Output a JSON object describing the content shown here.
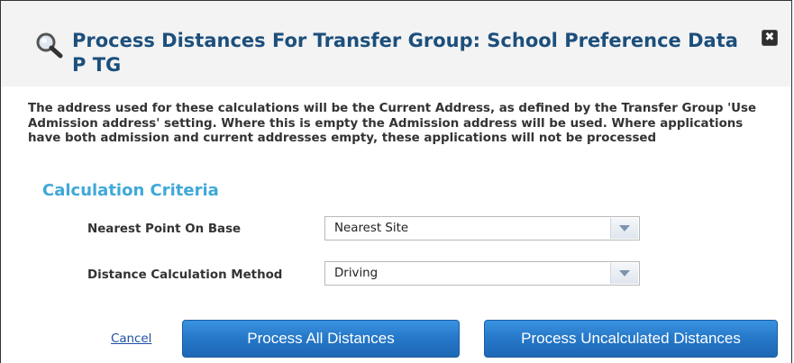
{
  "dialog": {
    "title": "Process Distances For Transfer Group: School Preference Data P TG",
    "close_glyph": "✖",
    "header_icon": "magnifier-icon",
    "description": "The address used for these calculations will be the Current Address, as defined by the Transfer Group 'Use Admission address' setting. Where this is empty the Admission address will be used. Where applications have both admission and current addresses empty, these applications will not be processed"
  },
  "criteria": {
    "section_title": "Calculation Criteria",
    "fields": [
      {
        "label": "Nearest Point On Base",
        "value": "Nearest Site"
      },
      {
        "label": "Distance Calculation Method",
        "value": "Driving"
      }
    ]
  },
  "actions": {
    "cancel": "Cancel",
    "process_all": "Process All Distances",
    "process_uncalculated": "Process Uncalculated Distances"
  },
  "colors": {
    "title": "#1c4f7c",
    "section": "#40a8d8",
    "button": "#2577c8",
    "link": "#1e4fa3"
  }
}
